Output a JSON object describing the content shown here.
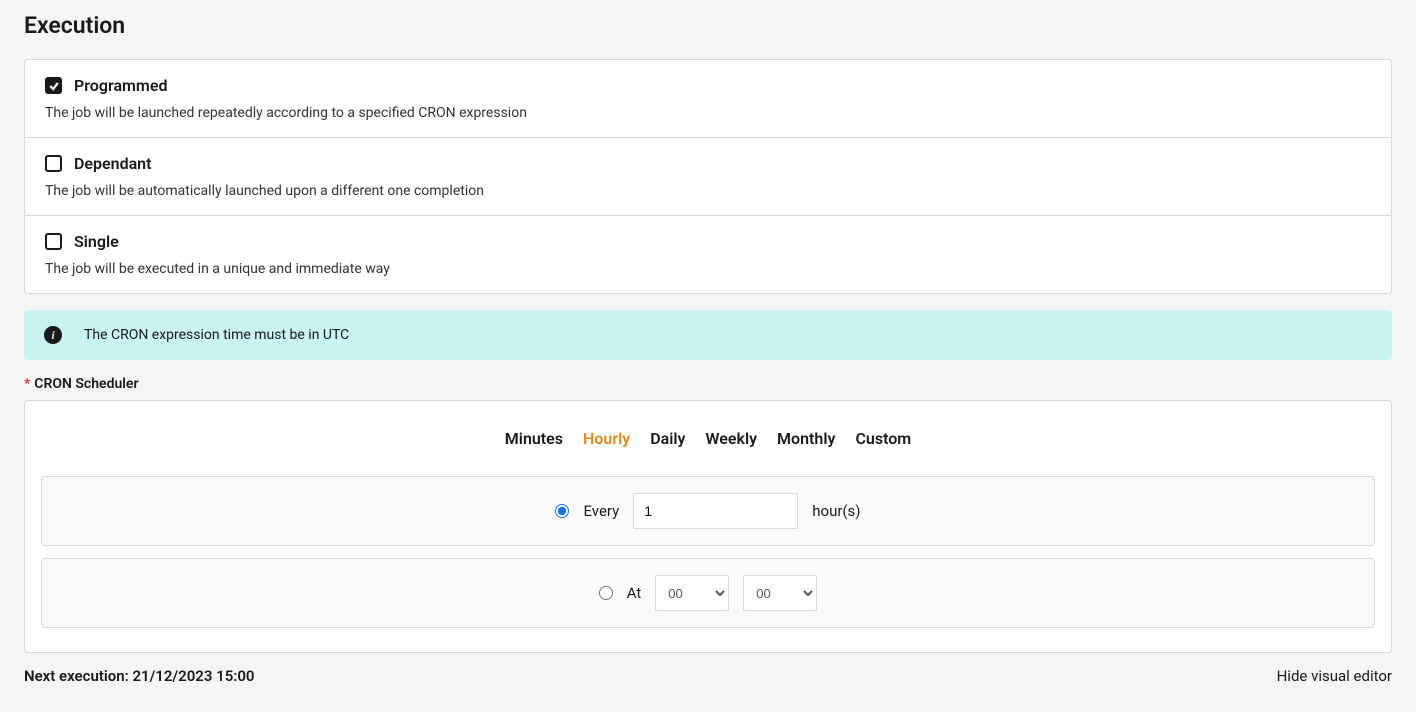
{
  "title": "Execution",
  "options": [
    {
      "label": "Programmed",
      "description": "The job will be launched repeatedly according to a specified CRON expression",
      "checked": true
    },
    {
      "label": "Dependant",
      "description": "The job will be automatically launched upon a different one completion",
      "checked": false
    },
    {
      "label": "Single",
      "description": "The job will be executed in a unique and immediate way",
      "checked": false
    }
  ],
  "alert": "The CRON expression time must be in UTC",
  "scheduler": {
    "label": "CRON Scheduler",
    "tabs": [
      "Minutes",
      "Hourly",
      "Daily",
      "Weekly",
      "Monthly",
      "Custom"
    ],
    "active_tab": "Hourly",
    "every": {
      "label": "Every",
      "value": "1",
      "suffix": "hour(s)"
    },
    "at": {
      "label": "At",
      "hour": "00",
      "minute": "00"
    }
  },
  "footer": {
    "next_label": "Next execution: ",
    "next_value": "21/12/2023 15:00",
    "hide_link": "Hide visual editor"
  }
}
